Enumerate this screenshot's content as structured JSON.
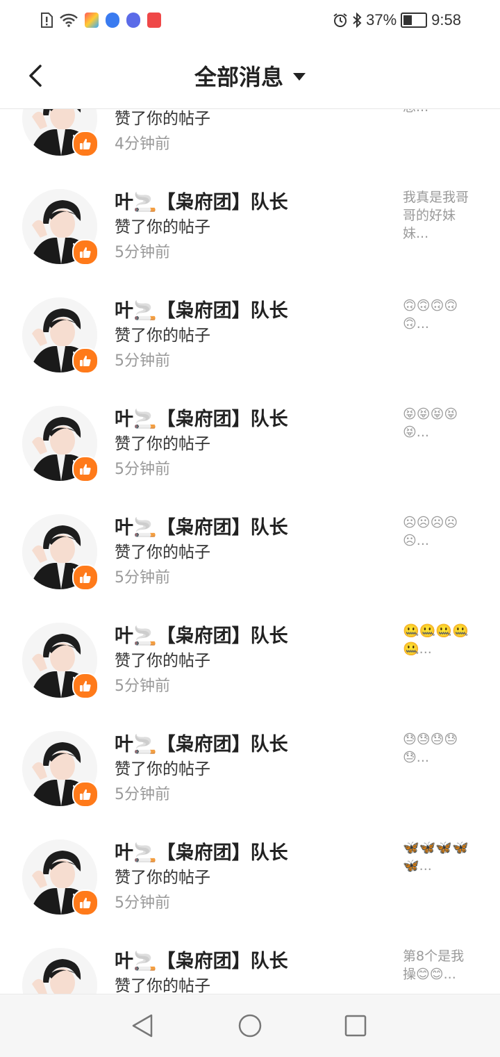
{
  "status_bar": {
    "battery_percent": "37%",
    "time": "9:58",
    "left_icons": [
      "sim-alert-icon",
      "wifi-icon",
      "app-icon-colorful",
      "app-icon-blue",
      "music-icon",
      "app-icon-red"
    ],
    "right_icons": [
      "alarm-icon",
      "bluetooth-icon",
      "battery-icon"
    ]
  },
  "header": {
    "title": "全部消息",
    "back_icon": "back-arrow-icon",
    "dropdown_icon": "caret-down-icon"
  },
  "messages": [
    {
      "name": "",
      "action": "赞了你的帖子",
      "time": "4分钟前",
      "snippet": "是，为朋友想..."
    },
    {
      "name": "叶🚬【枭府团】队长",
      "action": "赞了你的帖子",
      "time": "5分钟前",
      "snippet": "我真是我哥哥的好妹妹..."
    },
    {
      "name": "叶🚬【枭府团】队长",
      "action": "赞了你的帖子",
      "time": "5分钟前",
      "snippet": "🙃🙃🙃🙃🙃..."
    },
    {
      "name": "叶🚬【枭府团】队长",
      "action": "赞了你的帖子",
      "time": "5分钟前",
      "snippet": "😝😝😝😝😝..."
    },
    {
      "name": "叶🚬【枭府团】队长",
      "action": "赞了你的帖子",
      "time": "5分钟前",
      "snippet": "☹☹☹☹☹..."
    },
    {
      "name": "叶🚬【枭府团】队长",
      "action": "赞了你的帖子",
      "time": "5分钟前",
      "snippet": "🤐🤐🤐🤐🤐..."
    },
    {
      "name": "叶🚬【枭府团】队长",
      "action": "赞了你的帖子",
      "time": "5分钟前",
      "snippet": "😓😓😓😓😓..."
    },
    {
      "name": "叶🚬【枭府团】队长",
      "action": "赞了你的帖子",
      "time": "5分钟前",
      "snippet": "🦋🦋🦋🦋🦋..."
    },
    {
      "name": "叶🚬【枭府团】队长",
      "action": "赞了你的帖子",
      "time": "",
      "snippet": "第8个是我操😊😊..."
    }
  ],
  "nav_bar": {
    "icons": [
      "nav-back-icon",
      "nav-home-icon",
      "nav-recents-icon"
    ]
  },
  "colors": {
    "accent_orange": "#ff7a1a",
    "text_primary": "#222222",
    "text_secondary": "#999999"
  }
}
